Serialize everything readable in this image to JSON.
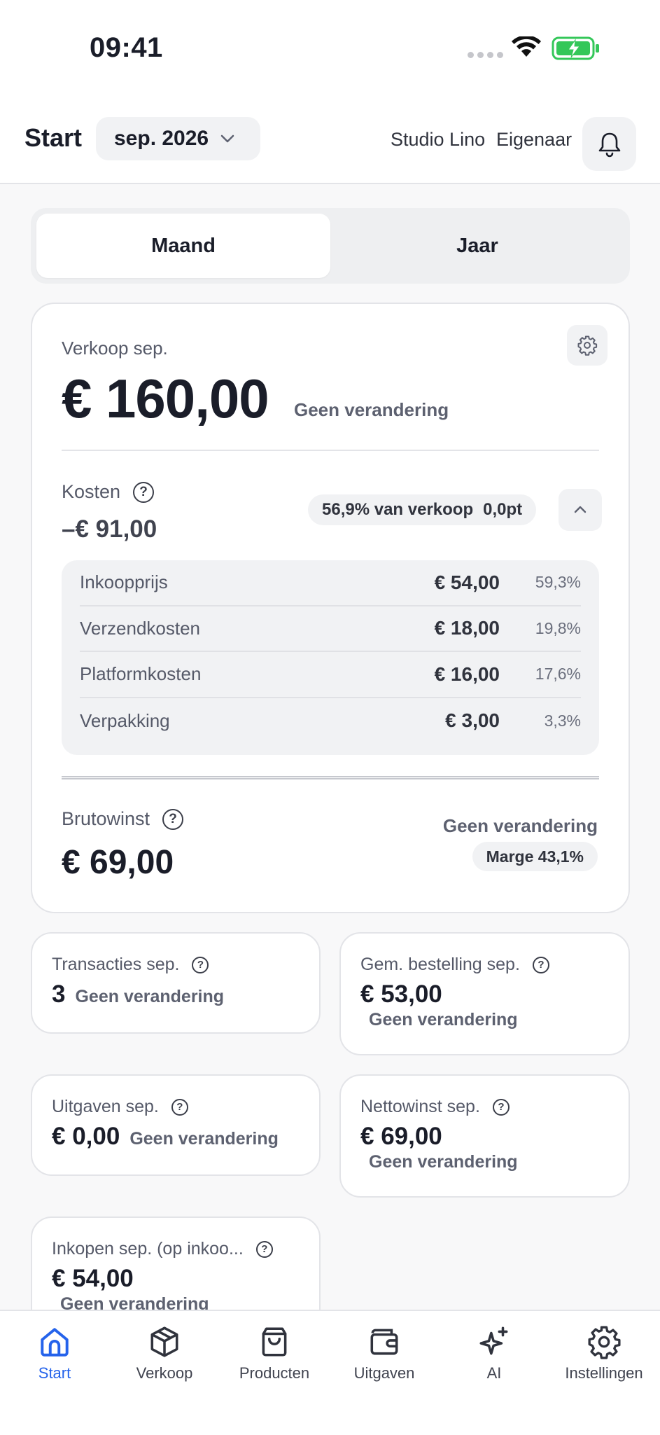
{
  "status_bar": {
    "time": "09:41"
  },
  "header": {
    "title": "Start",
    "month": "sep. 2026",
    "shop": "Studio Lino",
    "role": "Eigenaar"
  },
  "period_toggle": {
    "month": "Maand",
    "year": "Jaar",
    "selected": "Maand"
  },
  "sales": {
    "label": "Verkoop sep.",
    "amount": "€ 160,00",
    "change": "Geen verandering"
  },
  "costs": {
    "label": "Kosten",
    "amount": "–€ 91,00",
    "share": "56,9% van verkoop",
    "share_delta": "0,0pt",
    "breakdown": [
      {
        "name": "Inkoopprijs",
        "amount": "€ 54,00",
        "pct": "59,3%"
      },
      {
        "name": "Verzendkosten",
        "amount": "€ 18,00",
        "pct": "19,8%"
      },
      {
        "name": "Platformkosten",
        "amount": "€ 16,00",
        "pct": "17,6%"
      },
      {
        "name": "Verpakking",
        "amount": "€ 3,00",
        "pct": "3,3%"
      }
    ]
  },
  "gross_profit": {
    "label": "Brutowinst",
    "amount": "€ 69,00",
    "change": "Geen verandering",
    "margin": "Marge 43,1%"
  },
  "stats": {
    "transactions": {
      "label": "Transacties sep.",
      "value": "3",
      "change": "Geen verandering"
    },
    "avg_order": {
      "label": "Gem. bestelling sep.",
      "value": "€ 53,00",
      "change": "Geen verandering"
    },
    "expenses": {
      "label": "Uitgaven sep.",
      "value": "€ 0,00",
      "change": "Geen verandering"
    },
    "net_profit": {
      "label": "Nettowinst sep.",
      "value": "€ 69,00",
      "change": "Geen verandering"
    },
    "purchases": {
      "label": "Inkopen sep. (op inkoo...",
      "value": "€ 54,00",
      "change": "Geen verandering"
    }
  },
  "tabbar": {
    "active": "Start",
    "items": [
      {
        "label": "Start",
        "icon": "home-icon"
      },
      {
        "label": "Verkoop",
        "icon": "box-icon"
      },
      {
        "label": "Producten",
        "icon": "bag-icon"
      },
      {
        "label": "Uitgaven",
        "icon": "wallet-icon"
      },
      {
        "label": "AI",
        "icon": "sparkle-icon"
      },
      {
        "label": "Instellingen",
        "icon": "gear-icon"
      }
    ]
  },
  "colors": {
    "accent": "#2563eb",
    "battery": "#34c759",
    "text": "#1a1d29"
  }
}
